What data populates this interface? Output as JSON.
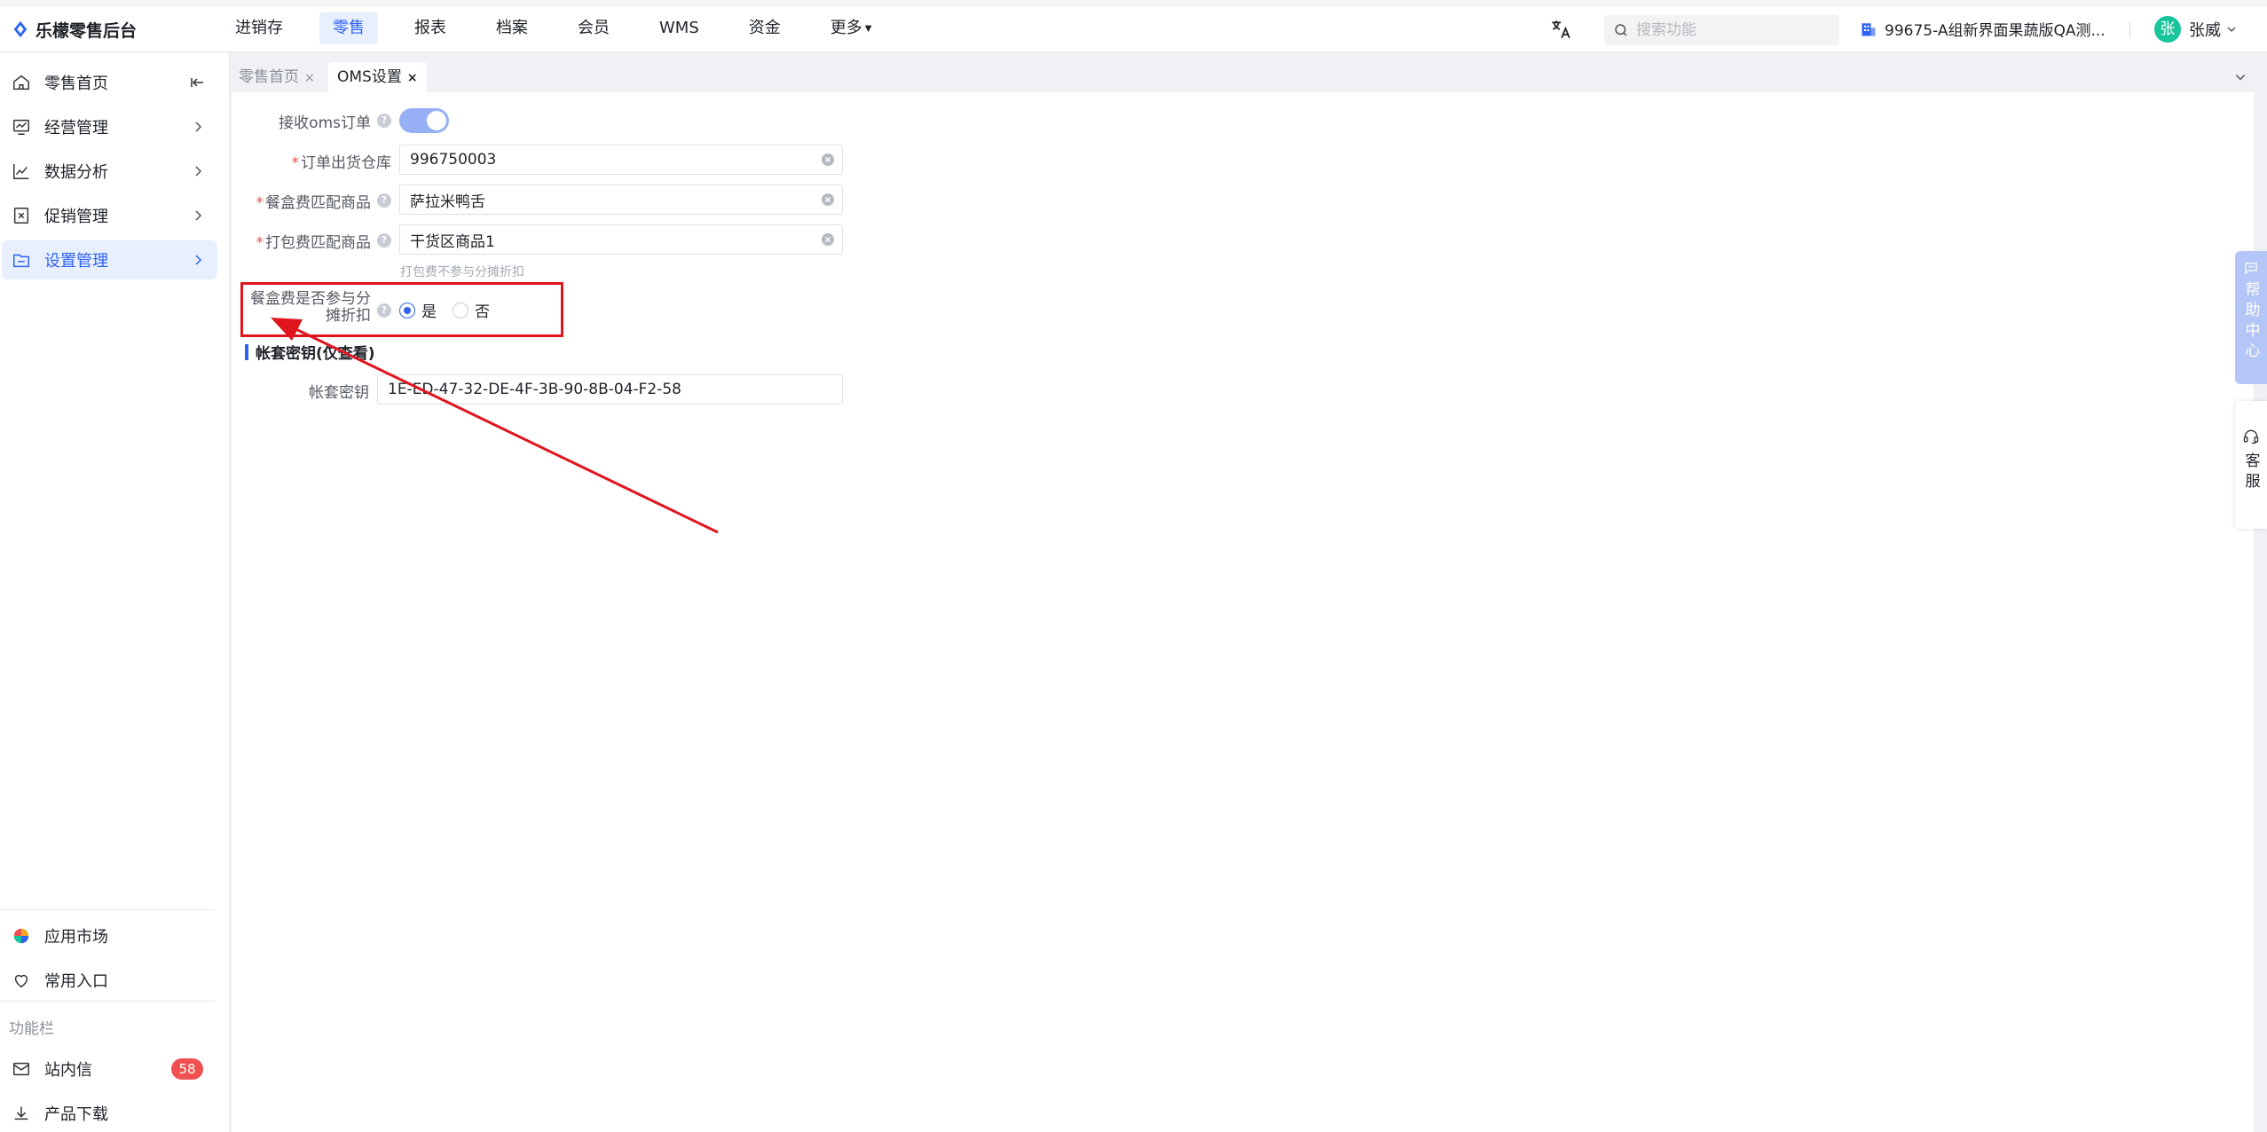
{
  "brand": {
    "name": "乐檬零售后台"
  },
  "topnav": {
    "items": [
      {
        "label": "进销存",
        "active": false
      },
      {
        "label": "零售",
        "active": true
      },
      {
        "label": "报表",
        "active": false
      },
      {
        "label": "档案",
        "active": false
      },
      {
        "label": "会员",
        "active": false
      },
      {
        "label": "WMS",
        "active": false
      },
      {
        "label": "资金",
        "active": false
      },
      {
        "label": "更多",
        "active": false
      }
    ]
  },
  "search": {
    "placeholder": "搜索功能"
  },
  "tenant": {
    "label": "99675-A组新界面果蔬版QA测..."
  },
  "user": {
    "avatar_char": "张",
    "name": "张威"
  },
  "sidebar": {
    "items": [
      {
        "label": "零售首页"
      },
      {
        "label": "经营管理"
      },
      {
        "label": "数据分析"
      },
      {
        "label": "促销管理"
      },
      {
        "label": "设置管理"
      }
    ],
    "bottom": [
      {
        "label": "应用市场"
      },
      {
        "label": "常用入口"
      }
    ],
    "section_label": "功能栏",
    "tools": [
      {
        "label": "站内信",
        "badge": "58"
      },
      {
        "label": "产品下载"
      }
    ]
  },
  "tabs": [
    {
      "label": "零售首页",
      "close": "×"
    },
    {
      "label": "OMS设置",
      "close": "×"
    }
  ],
  "form": {
    "receive_oms": {
      "label": "接收oms订单"
    },
    "warehouse": {
      "label": "订单出货仓库",
      "value": "996750003"
    },
    "box_fee_goods": {
      "label": "餐盒费匹配商品",
      "value": "萨拉米鸭舌"
    },
    "pack_fee_goods": {
      "label": "打包费匹配商品",
      "value": "干货区商品1",
      "hint": "打包费不参与分摊折扣"
    },
    "box_fee_discount": {
      "label_line1": "餐盒费是否参与分",
      "label_line2": "摊折扣",
      "yes": "是",
      "no": "否"
    },
    "account_section": {
      "title": "帐套密钥(仅查看)"
    },
    "account_key": {
      "label": "帐套密钥",
      "value": "1E-ED-47-32-DE-4F-3B-90-8B-04-F2-58"
    }
  },
  "float": {
    "help_center": "帮助中心",
    "service": "客服"
  },
  "colors": {
    "accent": "#2e63f0",
    "annotation_red": "#e0161f",
    "badge_red": "#f05050"
  }
}
